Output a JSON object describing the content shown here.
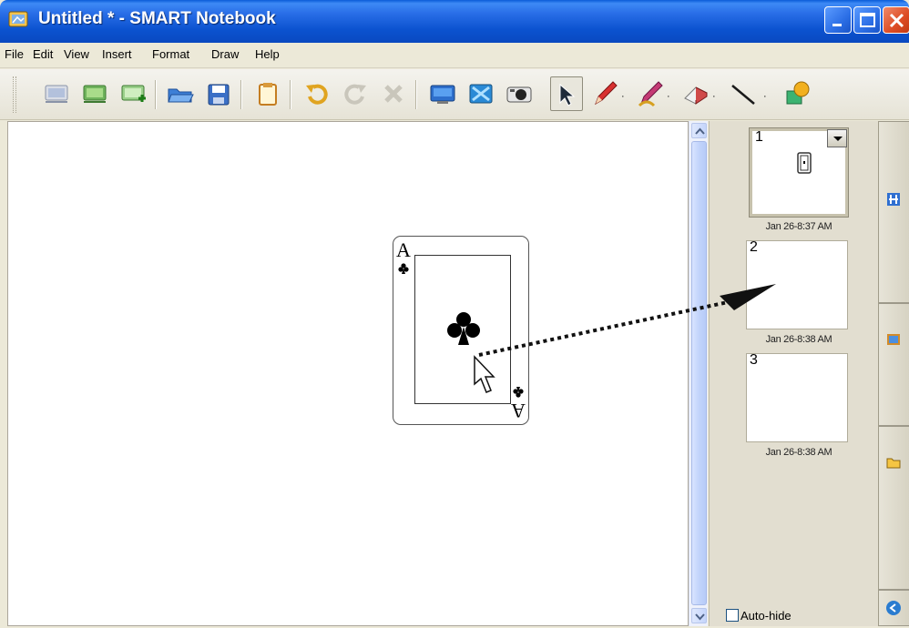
{
  "window": {
    "title": "Untitled * - SMART Notebook",
    "icon": "smart-notebook-app-icon",
    "controls": [
      "minimize-icon",
      "maximize-icon",
      "close-icon"
    ]
  },
  "menu": {
    "items": [
      "File",
      "Edit",
      "View",
      "Insert",
      "Format",
      "Draw",
      "Help"
    ]
  },
  "toolbar": {
    "tools": [
      "previous-page-icon",
      "next-page-icon",
      "add-page-icon",
      "open-file-icon",
      "save-icon",
      "paste-icon",
      "undo-icon",
      "redo-icon",
      "delete-icon",
      "full-screen-icon",
      "screen-shade-icon",
      "capture-icon",
      "select-arrow-icon",
      "pen-icon",
      "creative-pen-icon",
      "eraser-icon",
      "line-icon",
      "shapes-icon"
    ],
    "dropdown_glyph": "·"
  },
  "card": {
    "rank": "A",
    "suit": "clubs"
  },
  "annotation": {
    "description_arrow_color": "#111111"
  },
  "sorter": {
    "pages": [
      {
        "number": "1",
        "date": "Jan 26-8:37 AM"
      },
      {
        "number": "2",
        "date": "Jan 26-8:38 AM"
      },
      {
        "number": "3",
        "date": "Jan 26-8:38 AM"
      }
    ],
    "autohide_label": "Auto-hide"
  },
  "sidetabs": {
    "icons": [
      "page-sorter-icon",
      "gallery-icon",
      "attachments-icon",
      "properties-icon"
    ]
  }
}
